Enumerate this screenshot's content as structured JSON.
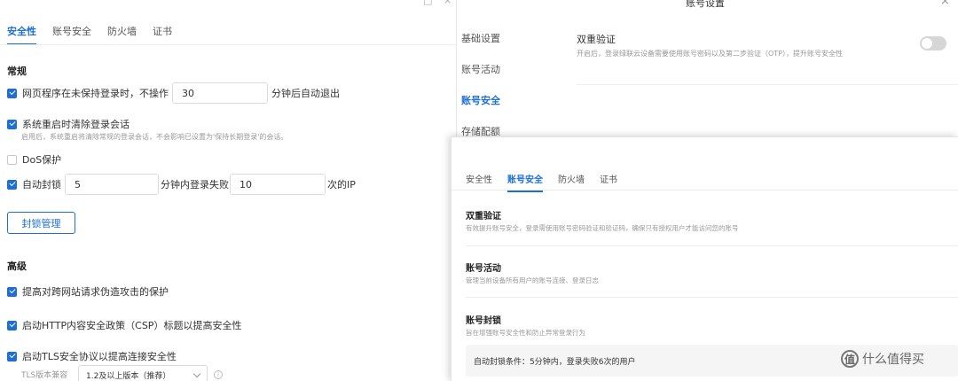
{
  "left": {
    "window_controls": [
      "□",
      "×"
    ],
    "tabs": [
      {
        "label": "安全性",
        "active": true
      },
      {
        "label": "账号安全",
        "active": false
      },
      {
        "label": "防火墙",
        "active": false
      },
      {
        "label": "证书",
        "active": false
      }
    ],
    "general": {
      "title": "常规",
      "timeout_label": "网页程序在未保持登录时，不操作",
      "timeout_value": "30",
      "timeout_suffix": "分钟后自动退出",
      "clear_session_label": "系统重启时清除登录会话",
      "clear_session_hint": "启用后，系统重启将清除常规的登录会话，不会影响已设置为'保持长期登录'的会话。",
      "dos_label": "DoS保护",
      "autoblock_label": "自动封锁",
      "autoblock_minutes": "5",
      "autoblock_mid": "分钟内登录失败",
      "autoblock_count": "10",
      "autoblock_suffix": "次的IP",
      "block_manage_button": "封锁管理"
    },
    "advanced": {
      "title": "高级",
      "csrf_label": "提高对跨网站请求伪造攻击的保护",
      "csp_label": "启动HTTP内容安全政策（CSP）标题以提高安全性",
      "tls_label": "启动TLS安全协议以提高连接安全性",
      "tls_compat_label": "TLS版本兼容",
      "tls_compat_value": "1.2及以上版本（推荐）"
    }
  },
  "dialog": {
    "title": "账号设置",
    "close": "×",
    "nav": [
      {
        "label": "基础设置",
        "active": false
      },
      {
        "label": "账号活动",
        "active": false
      },
      {
        "label": "账号安全",
        "active": true
      },
      {
        "label": "存储配额",
        "active": false
      }
    ],
    "two_factor_title": "双重验证",
    "two_factor_desc": "开启后，登录绿联云设备需要使用账号密码以及第二步验证（OTP），提升账号安全性"
  },
  "overlay": {
    "tabs": [
      {
        "label": "安全性",
        "active": false
      },
      {
        "label": "账号安全",
        "active": true
      },
      {
        "label": "防火墙",
        "active": false
      },
      {
        "label": "证书",
        "active": false
      }
    ],
    "cards": [
      {
        "title": "双重验证",
        "desc": "有效提升账号安全，登录需使用账号密码验证和验证码，确保只有授权用户才能访问您的账号"
      },
      {
        "title": "账号活动",
        "desc": "管理当前设备所有用户的账号连接、登录日志"
      },
      {
        "title": "账号封锁",
        "desc": "旨在增强账号安全性和防止异常登录行为"
      }
    ],
    "lock_condition": "自动封锁条件：5分钟内，登录失败6次的用户"
  },
  "watermark": {
    "icon": "值",
    "text": "什么值得买"
  },
  "colors": {
    "accent": "#1d6fd1",
    "toggle_off": "#d6d6d6"
  }
}
